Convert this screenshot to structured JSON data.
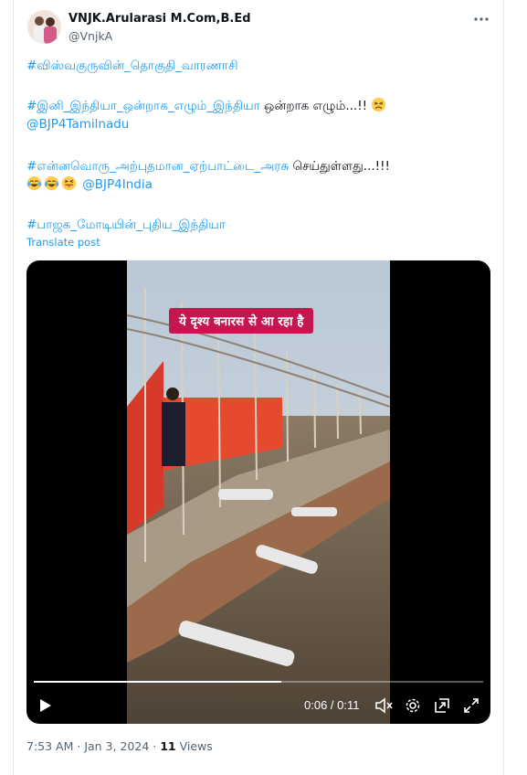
{
  "author": {
    "name": "VNJK.Arularasi M.Com,B.Ed",
    "handle": "@VnjkA"
  },
  "tweet": {
    "line1": "#விஸ்வகுருவின்_தொகுதி_வாரணாசி",
    "line2_tag": "#இனி_இந்தியா_ஒன்றாக_எழும்_இந்தியா",
    "line2_text": " ஒன்றாக எழும்...!! ",
    "line3_mention": "@BJP4Tamilnadu",
    "line4_tag": "#என்னவொரு_அற்புதமான_ஏற்பாட்டை_அரசு",
    "line4_text": " செய்துள்ளது...!!!",
    "line5_mention": "@BJP4India",
    "line6_tag": "#பாஜக_மோடியின்_புதிய_இந்தியா",
    "emojis": [
      "weary-face",
      "tears-of-joy",
      "tears-of-joy",
      "squinting-tongue"
    ]
  },
  "translate_label": "Translate post",
  "video": {
    "caption": "ये दृश्य बनारस से आ रहा है",
    "time_text": "0:06 / 0:11",
    "progress": 0.55
  },
  "meta": {
    "time": "7:53 AM",
    "date": "Jan 3, 2024",
    "views_count": "11",
    "views_label": "Views",
    "sep": " · "
  },
  "colors": {
    "accent": "#1d9bf0",
    "caption_bg": "#c4174f",
    "text": "#0f1419",
    "secondary": "#536471"
  }
}
